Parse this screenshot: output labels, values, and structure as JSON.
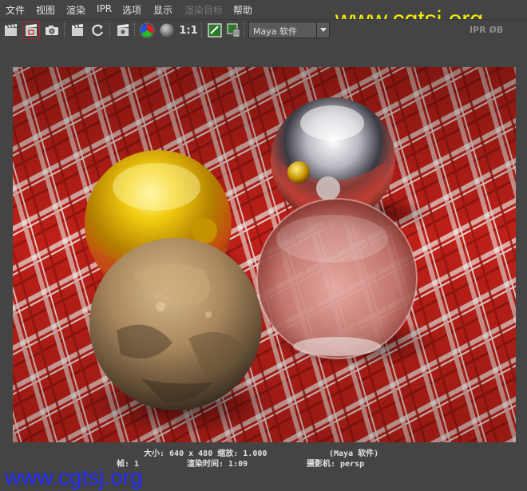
{
  "menu": {
    "file": "文件",
    "view": "视图",
    "render": "渲染",
    "ipr": "IPR",
    "options": "选项",
    "display": "显示",
    "render_target": "渲染目标",
    "help": "帮助"
  },
  "toolbar": {
    "ratio_label": "1:1",
    "renderer_select": "Maya 软件",
    "right_label": "IPR  ØB"
  },
  "watermark": {
    "top": "www.cgtsj.org",
    "bottom": "www.cgtsj.org"
  },
  "status": {
    "size": "大小: 640 x 480 缩放: 1.000",
    "renderer": "(Maya 软件)",
    "frame": "帧: 1",
    "render_time": "渲染时间: 1:09",
    "camera": "摄影机: persp"
  },
  "colors": {
    "ui_bg": "#444444",
    "watermark_top": "#f2f200",
    "watermark_bottom": "#1f2cff",
    "cloth_red": "#d4251c",
    "gold": "#e6b800"
  }
}
